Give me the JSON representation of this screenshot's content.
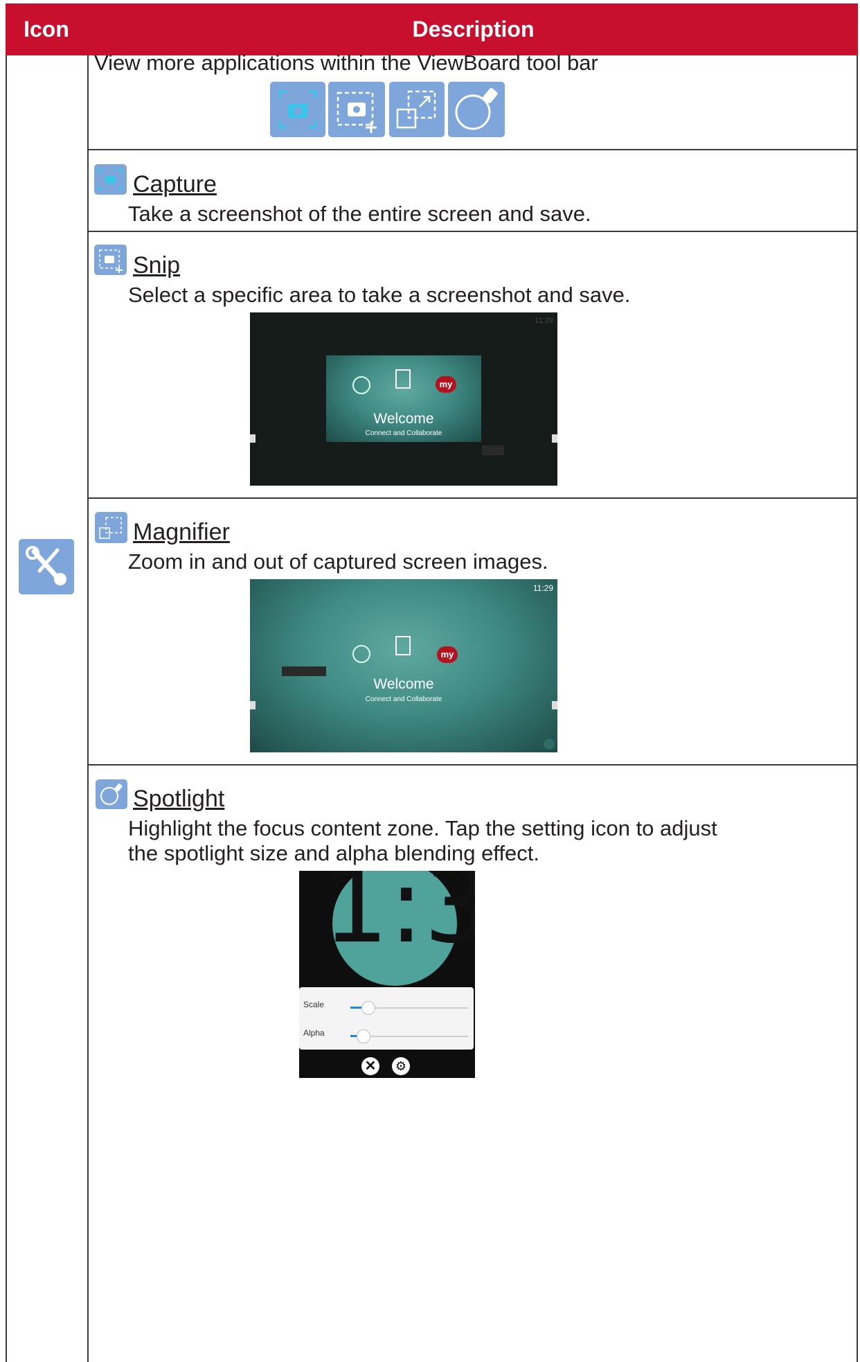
{
  "header": {
    "icon_col": "Icon",
    "desc_col": "Description"
  },
  "intro": {
    "text": "View more applications within the ViewBoard tool bar"
  },
  "toolbar_icons": [
    "capture-icon",
    "snip-icon",
    "magnifier-icon",
    "spotlight-icon"
  ],
  "tool_icon": "tools-icon",
  "items": [
    {
      "title": "Capture",
      "desc": "Take a screenshot of the entire screen and save."
    },
    {
      "title": "Snip",
      "desc": "Select a specific area to take a screenshot and save."
    },
    {
      "title": "Magnifier",
      "desc": "Zoom in and out of captured screen images."
    },
    {
      "title": "Spotlight",
      "desc1": "Highlight the focus content zone. Tap the setting icon to adjust",
      "desc2": "the spotlight size and alpha blending effect."
    }
  ],
  "screens": {
    "time": "11:29",
    "welcome": "Welcome",
    "tagline": "Connect and Collaborate",
    "app_label": "my",
    "spotlight_digits": "1:3",
    "scale_label": "Scale",
    "alpha_label": "Alpha",
    "scale_value": 0.12,
    "alpha_value": 0.08
  },
  "colors": {
    "brand_red": "#c8102e",
    "icon_blue": "#7ea6da",
    "teal": "#3f8a83"
  }
}
